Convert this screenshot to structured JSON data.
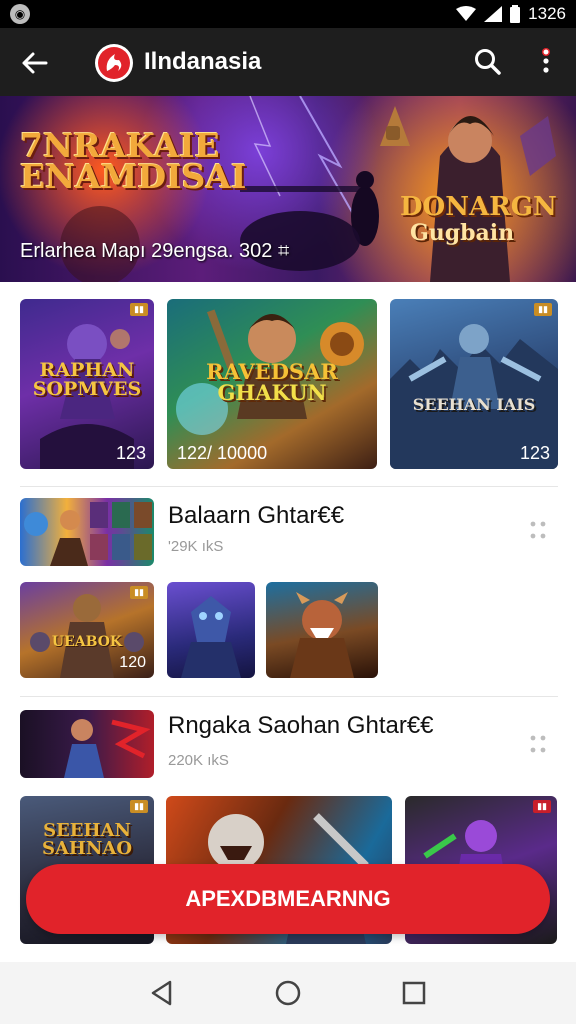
{
  "status_bar": {
    "time": "1326"
  },
  "app_bar": {
    "title": "Ilndanasia"
  },
  "banner": {
    "left_title_line1": "7NRAKAIE",
    "left_title_line2": "ENAMDISAI",
    "left_subtitle": "",
    "right_title_line1": "DONARGN",
    "right_title_line2": "Gugbain",
    "caption": "Erlarhea Mapı 29engsa. 302 ⌗"
  },
  "featured_cards": [
    {
      "title_line1": "RAPHAN",
      "title_line2": "SOPMVES",
      "count": "123"
    },
    {
      "title_line1": "RAVEDSAR",
      "title_line2": "GHAKUN",
      "count": "122/ 10000"
    },
    {
      "title_line1": "SEEHAN IAIS",
      "count": "123"
    }
  ],
  "section1": {
    "title": "Balaarn Ghtar€€",
    "subtitle": "'29K ıkS",
    "card_title": "UEABOK",
    "card_count": "120"
  },
  "section2": {
    "title": "Rngaka Saohan Ghtar€€",
    "subtitle": "220K ıkS"
  },
  "bottom_card": {
    "title_line1": "SEEHAN",
    "title_line2": "SAHNAO"
  },
  "cta": {
    "label": "APEXDBMEARNNG"
  },
  "colors": {
    "accent": "#e1232a",
    "app_bar": "#1e1e1e",
    "status_bar": "#000000"
  }
}
